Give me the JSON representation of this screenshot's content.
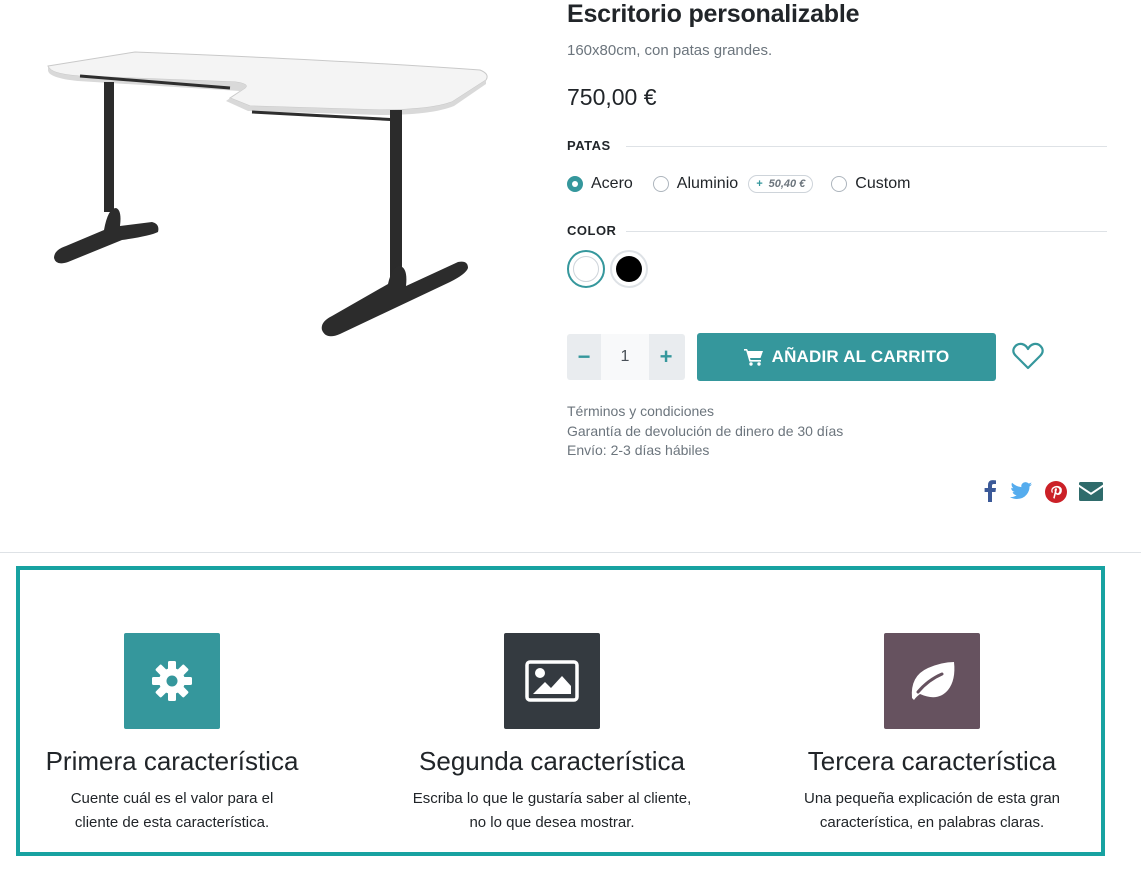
{
  "product": {
    "title": "Escritorio personalizable",
    "subtitle": "160x80cm, con patas grandes.",
    "price": "750,00 €"
  },
  "attributes": {
    "legs": {
      "label": "PATAS",
      "options": [
        {
          "label": "Acero",
          "checked": true
        },
        {
          "label": "Aluminio",
          "checked": false,
          "extra_plus": "+",
          "extra_price": "50,40 €"
        },
        {
          "label": "Custom",
          "checked": false
        }
      ]
    },
    "color": {
      "label": "COLOR",
      "swatches": [
        {
          "name": "white",
          "color": "#ffffff",
          "selected": true
        },
        {
          "name": "black",
          "color": "#000000",
          "selected": false
        }
      ]
    }
  },
  "quantity": {
    "value": "1",
    "minus": "−",
    "plus": "+"
  },
  "cart_button": {
    "label": "AÑADIR AL CARRITO",
    "icon": "shopping-cart-icon"
  },
  "wishlist": {
    "icon": "heart-icon"
  },
  "info": {
    "terms": "Términos y condiciones",
    "guarantee": "Garantía de devolución de dinero de 30 días",
    "shipping": "Envío: 2-3 días hábiles"
  },
  "share": [
    {
      "icon": "facebook-icon",
      "color": "#3b5998"
    },
    {
      "icon": "twitter-icon",
      "color": "#55acee"
    },
    {
      "icon": "pinterest-icon",
      "color": "#cb2027"
    },
    {
      "icon": "email-icon",
      "color": "#2f6b6b"
    }
  ],
  "features": [
    {
      "title": "Primera característica",
      "desc_line1": "Cuente cuál es el valor para el",
      "desc_line2": "cliente de esta característica.",
      "icon": "gear-icon",
      "bg": "#35979c"
    },
    {
      "title": "Segunda característica",
      "desc_line1": "Escriba lo que le gustaría saber al cliente,",
      "desc_line2": "no lo que desea mostrar.",
      "icon": "image-icon",
      "bg": "#343a40"
    },
    {
      "title": "Tercera característica",
      "desc_line1": "Una pequeña explicación de esta gran",
      "desc_line2": "característica, en palabras claras.",
      "icon": "leaf-icon",
      "bg": "#66525f"
    }
  ]
}
